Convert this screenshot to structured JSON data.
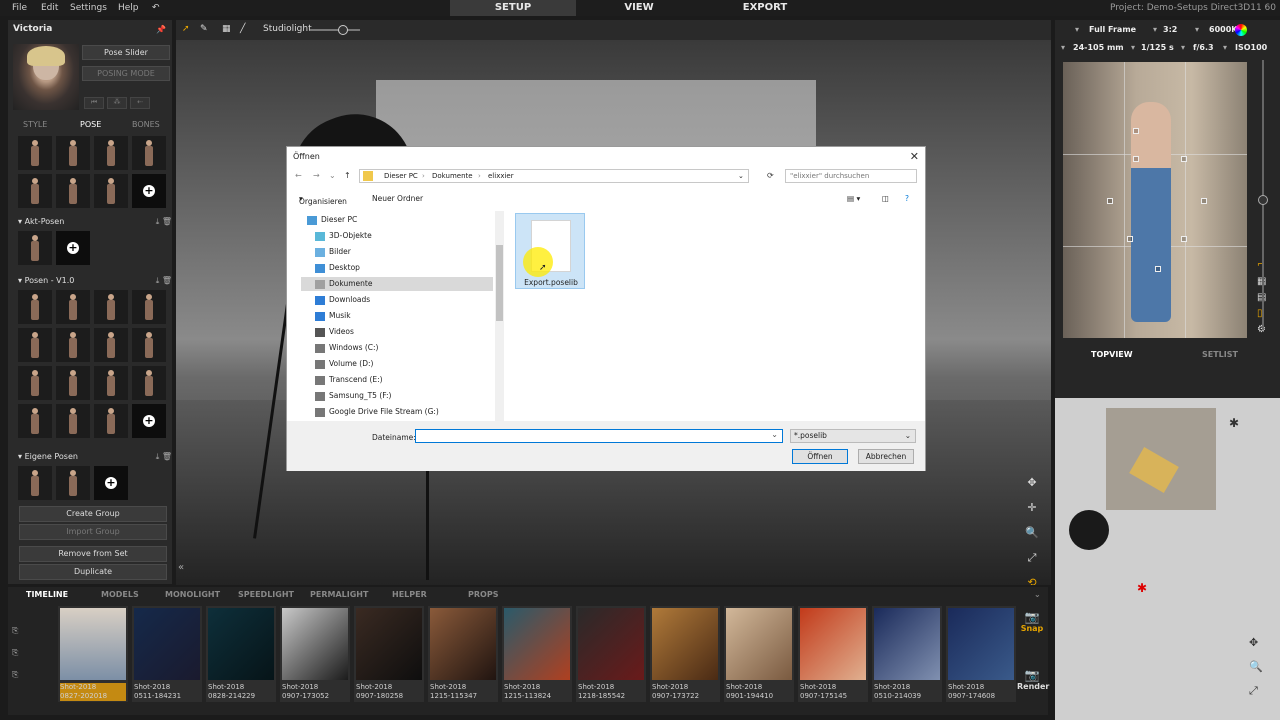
{
  "menubar": {
    "file": "File",
    "edit": "Edit",
    "settings": "Settings",
    "help": "Help",
    "tabs": [
      "SETUP",
      "VIEW",
      "EXPORT"
    ],
    "project": "Project: Demo-Setups  Direct3D11   60"
  },
  "left": {
    "title": "Victoria",
    "pose_slider": "Pose Slider",
    "posing_mode": "POSING MODE",
    "subtabs": [
      "STYLE",
      "POSE",
      "BONES"
    ],
    "groups": [
      "Akt-Posen",
      "Posen - V1.0",
      "Eigene Posen"
    ],
    "buttons": [
      "Create Group",
      "Import Group",
      "Remove from Set",
      "Duplicate"
    ]
  },
  "toolbar": {
    "light": "Studiolight"
  },
  "dialog": {
    "title": "Öffnen",
    "crumbs": [
      "Dieser PC",
      "Dokumente",
      "elixxier"
    ],
    "search_placeholder": "\"elixxier\" durchsuchen",
    "organize": "Organisieren",
    "new_folder": "Neuer Ordner",
    "tree": [
      "Dieser PC",
      "3D-Objekte",
      "Bilder",
      "Desktop",
      "Dokumente",
      "Downloads",
      "Musik",
      "Videos",
      "Windows (C:)",
      "Volume (D:)",
      "Transcend (E:)",
      "Samsung_T5 (F:)",
      "Google Drive File Stream (G:)"
    ],
    "file": "Export.poselib",
    "filename_label": "Dateiname:",
    "filetype": "*.poselib",
    "open": "Öffnen",
    "cancel": "Abbrechen"
  },
  "right": {
    "frame": "Full Frame",
    "ratio": "3:2",
    "kelvin": "6000K",
    "lens": "24-105 mm",
    "shutter": "1/125 s",
    "aperture": "f/6.3",
    "iso": "ISO100",
    "tabs": [
      "TOPVIEW",
      "SETLIST"
    ]
  },
  "timeline": {
    "tabs": [
      "TIMELINE",
      "MODELS",
      "MONOLIGHT",
      "SPEEDLIGHT",
      "PERMALIGHT",
      "HELPER",
      "PROPS"
    ],
    "shots": [
      [
        "Shot-2018",
        "0827-202018"
      ],
      [
        "Shot-2018",
        "0511-184231"
      ],
      [
        "Shot-2018",
        "0828-214229"
      ],
      [
        "Shot-2018",
        "0907-173052"
      ],
      [
        "Shot-2018",
        "0907-180258"
      ],
      [
        "Shot-2018",
        "1215-115347"
      ],
      [
        "Shot-2018",
        "1215-113824"
      ],
      [
        "Shot-2018",
        "1218-185542"
      ],
      [
        "Shot-2018",
        "0907-173722"
      ],
      [
        "Shot-2018",
        "0901-194410"
      ],
      [
        "Shot-2018",
        "0907-175145"
      ],
      [
        "Shot-2018",
        "0510-214039"
      ],
      [
        "Shot-2018",
        "0907-174608"
      ]
    ],
    "snap": "Snap",
    "render": "Render"
  },
  "colors": {
    "accent": "#e6a400",
    "dialog_blue": "#0078d7",
    "selected_shot": "#c48a12"
  }
}
